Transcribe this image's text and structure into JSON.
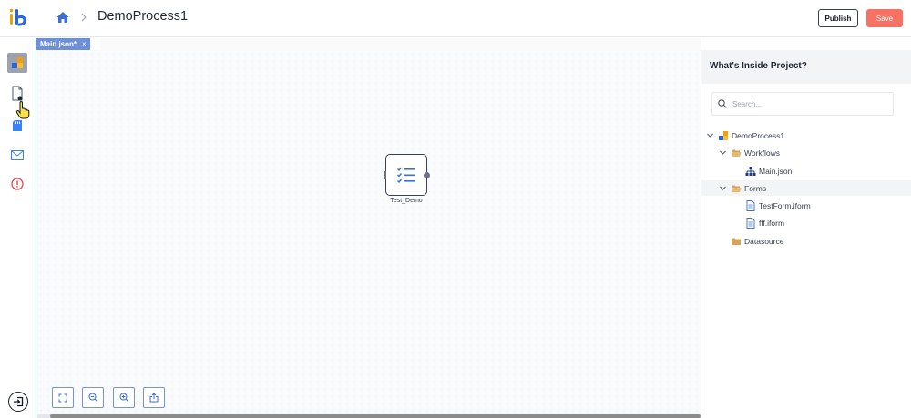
{
  "header": {
    "title": "DemoProcess1",
    "publish_label": "Publish",
    "save_label": "Save",
    "logo_text": "ib"
  },
  "sidebar": {
    "items": [
      {
        "name": "sidebar-item-process",
        "icon": "process-icon",
        "active": true
      },
      {
        "name": "sidebar-item-document",
        "icon": "document-icon"
      },
      {
        "name": "sidebar-item-storage",
        "icon": "sd-card-icon"
      },
      {
        "name": "sidebar-item-mail",
        "icon": "mail-icon"
      },
      {
        "name": "sidebar-item-alerts",
        "icon": "alert-icon"
      }
    ],
    "exit_icon": "exit-icon"
  },
  "tab": {
    "label": "Main.json*",
    "close": "×"
  },
  "canvas": {
    "node_label": "Test_Demo",
    "node_icon": "checklist-icon",
    "zoom_controls": [
      "fit-screen-icon",
      "zoom-out-icon",
      "zoom-in-icon",
      "export-icon"
    ]
  },
  "panel": {
    "title": "What's Inside Project?",
    "search_placeholder": "Search...",
    "tree": [
      {
        "label": "DemoProcess1",
        "icon": "project-icon"
      },
      {
        "label": "Workflows",
        "icon": "folder-open-icon"
      },
      {
        "label": "Main.json",
        "icon": "workflow-icon"
      },
      {
        "label": "Forms",
        "icon": "folder-open-icon"
      },
      {
        "label": "TestForm.iform",
        "icon": "file-icon"
      },
      {
        "label": "fff.iform",
        "icon": "file-icon"
      },
      {
        "label": "Datasource",
        "icon": "folder-icon"
      }
    ]
  },
  "colors": {
    "accent": "#f87264",
    "tab": "#6d8fd8",
    "brand_blue": "#2563eb",
    "brand_orange": "#f59e0b"
  }
}
